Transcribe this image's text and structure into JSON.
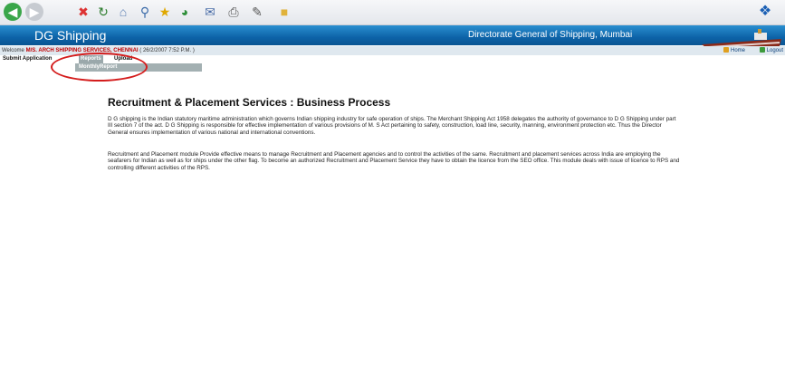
{
  "header": {
    "app_title": "DG Shipping",
    "org_title": "Directorate General of Shipping, Mumbai"
  },
  "welcome": {
    "prefix": "Welcome",
    "company": "M/S. ARCH SHIPPING SERVICES, CHENNAI",
    "datetime": "( 26/2/2007 7:52 P.M. )",
    "home_label": "Home",
    "logout_label": "Logout"
  },
  "menu": {
    "items": [
      "Submit Application",
      "Reports",
      "Upload"
    ],
    "submenu": [
      "MonthlyReport"
    ]
  },
  "content": {
    "title": "Recruitment & Placement Services : Business Process",
    "paragraphs": [
      "D G shipping is the Indian statutory maritime administration which governs Indian shipping industry for safe operation of ships. The Merchant Shipping Act 1958 delegates the authority of governance to D G Shipping under part III section 7 of the act. D G Shipping is responsible for effective implementation of various provisions of M. S Act pertaining to safety, construction, load line, security, manning, environment protection etc. Thus the Director General ensures implementation of various national and international conventions.",
      "Recruitment and Placement module Provide effective means to manage Recruitment and Placement agencies and to control the activities of the same. Recruitment and placement services across India are employing the seafarers for Indian as well as for ships under the other flag. To become an authorized Recruitment and Placement Service they have to obtain the licence from the SEO office. This module deals with issue of licence to RPS and controlling different activities of the RPS."
    ]
  },
  "colors": {
    "header_blue": "#0d63a8",
    "company_red": "#c00000",
    "highlight_red": "#d41c1c",
    "menu_grey": "#9aa8ab"
  },
  "icons": {
    "toolbar": [
      "back-icon",
      "forward-icon",
      "stop-icon",
      "refresh-icon",
      "home-icon",
      "search-icon",
      "favorites-icon",
      "history-icon",
      "mail-icon",
      "print-icon",
      "edit-icon",
      "folder-icon"
    ]
  }
}
